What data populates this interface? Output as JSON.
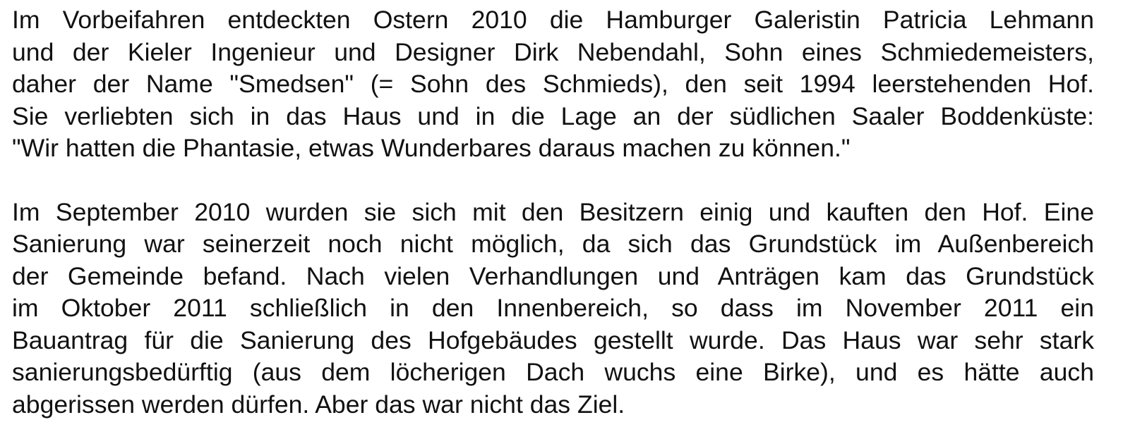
{
  "document": {
    "paragraphs": [
      {
        "lines": [
          "Im Vorbeifahren entdeckten Ostern 2010 die Hamburger Galeristin Patricia Lehmann",
          "und der Kieler Ingenieur und Designer Dirk Nebendahl, Sohn eines Schmiedemeisters,",
          "daher der Name \"Smedsen\" (= Sohn des Schmieds), den seit 1994 leerstehenden Hof.",
          "Sie verliebten sich in das Haus und in die Lage an der südlichen Saaler Boddenküste:",
          "\"Wir hatten die Phantasie, etwas Wunderbares daraus machen zu können.\""
        ]
      },
      {
        "lines": [
          "Im September 2010 wurden sie sich mit den Besitzern einig und kauften den Hof. Eine",
          "Sanierung war seinerzeit noch nicht möglich, da sich das Grundstück im Außenbereich",
          "der Gemeinde befand. Nach vielen Verhandlungen und Anträgen kam das Grundstück",
          "im Oktober 2011 schließlich in den Innenbereich, so dass im November 2011 ein",
          "Bauantrag für die Sanierung des Hofgebäudes gestellt wurde. Das Haus war sehr stark",
          "sanierungsbedürftig (aus dem löcherigen Dach wuchs eine Birke), und es hätte auch",
          "abgerissen werden dürfen. Aber das war nicht das Ziel."
        ]
      }
    ]
  }
}
